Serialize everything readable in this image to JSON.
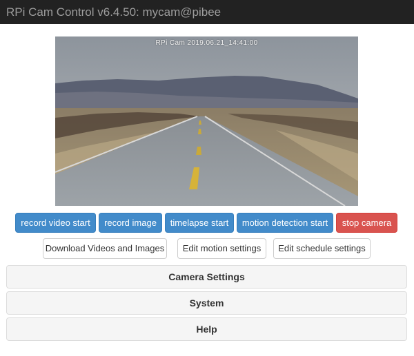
{
  "navbar": {
    "title": "RPi Cam Control v6.4.50: mycam@pibee"
  },
  "preview": {
    "overlay_text": "RPi Cam  2019.06.21_14:41:00"
  },
  "controls": {
    "record_video": "record video start",
    "record_image": "record image",
    "timelapse": "timelapse start",
    "motion_detection": "motion detection start",
    "stop_camera": "stop camera"
  },
  "links": {
    "download": "Download Videos and Images",
    "motion_settings": "Edit motion settings",
    "schedule_settings": "Edit schedule settings"
  },
  "panels": {
    "camera_settings": "Camera Settings",
    "system": "System",
    "help": "Help"
  },
  "colors": {
    "navbar_bg": "#222222",
    "primary": "#428bca",
    "danger": "#d9534f",
    "panel_bg": "#f5f5f5"
  }
}
